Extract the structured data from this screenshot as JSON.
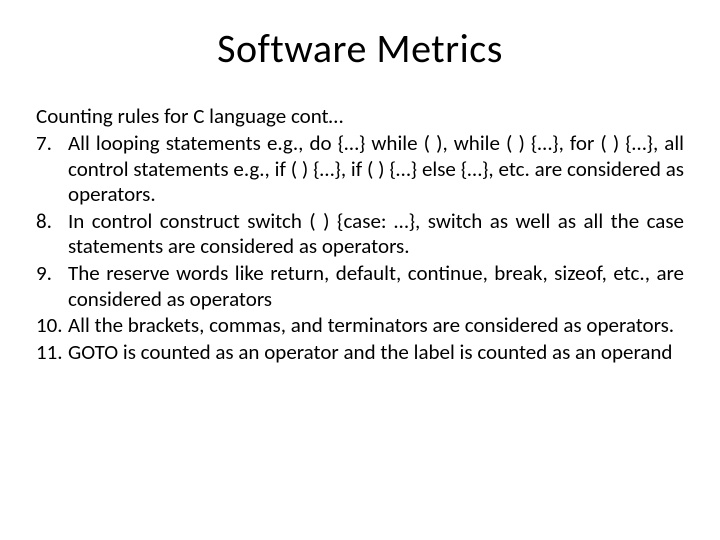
{
  "title": "Software Metrics",
  "subtitle": "Counting rules for C language cont…",
  "items": [
    {
      "num": "7.",
      "text": "All looping statements e.g., do {…} while ( ), while ( ) {…}, for ( ) {…}, all control statements e.g., if ( ) {…}, if ( )  {…} else {…}, etc. are considered as operators."
    },
    {
      "num": "8.",
      "text": " In control construct switch ( ) {case: …}, switch as well as all the case statements are considered as operators."
    },
    {
      "num": "9.",
      "text": "The reserve words like return, default, continue, break, sizeof, etc., are considered as operators"
    },
    {
      "num": "10.",
      "text": "All the brackets, commas, and terminators are considered as operators."
    },
    {
      "num": "11.",
      "text": "GOTO is counted as an operator and the label is  counted as an operand"
    }
  ]
}
